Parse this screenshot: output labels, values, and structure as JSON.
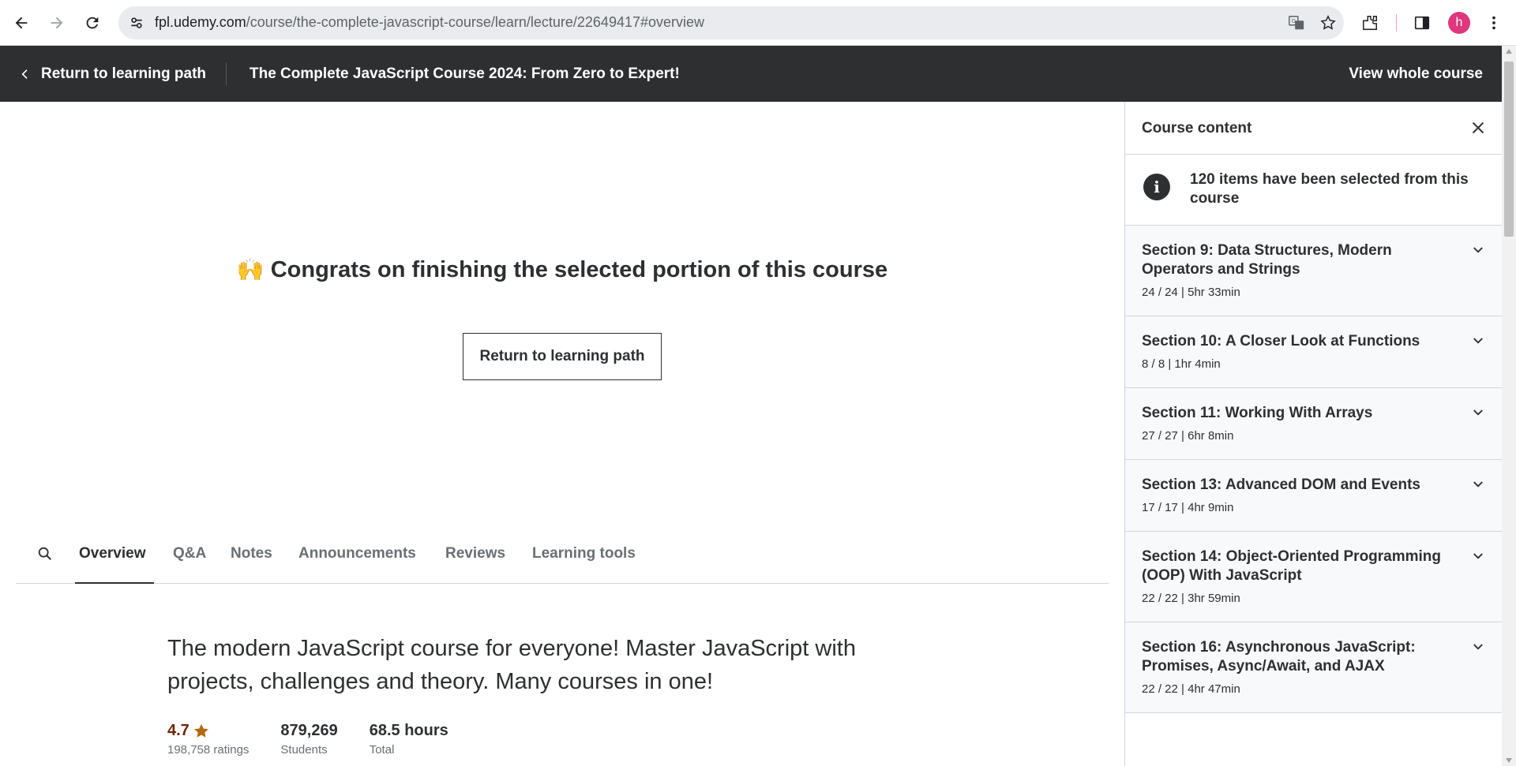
{
  "browser": {
    "url_host": "fpl.udemy.com",
    "url_path": "/course/the-complete-javascript-course/learn/lecture/22649417#overview",
    "profile_initial": "h",
    "profile_color": "#e0367d"
  },
  "header": {
    "back_label": "Return to learning path",
    "course_title": "The Complete JavaScript Course 2024: From Zero to Expert!",
    "view_whole_label": "View whole course"
  },
  "main": {
    "congrats_emoji": "🙌",
    "congrats_text": "Congrats on finishing the selected portion of this course",
    "return_button": "Return to learning path",
    "tabs": [
      {
        "label": "Overview",
        "active": true
      },
      {
        "label": "Q&A"
      },
      {
        "label": "Notes"
      },
      {
        "label": "Announcements"
      },
      {
        "label": "Reviews"
      },
      {
        "label": "Learning tools"
      }
    ],
    "description": "The modern JavaScript course for everyone! Master JavaScript with projects, challenges and theory. Many courses in one!",
    "stats": {
      "rating": "4.7",
      "ratings_count": "198,758 ratings",
      "students": "879,269",
      "students_label": "Students",
      "hours": "68.5 hours",
      "hours_label": "Total"
    }
  },
  "sidebar": {
    "title": "Course content",
    "info_text": "120 items have been selected from this course",
    "sections": [
      {
        "title": "Section 9: Data Structures, Modern Operators and Strings",
        "meta": "24 / 24 | 5hr 33min"
      },
      {
        "title": "Section 10: A Closer Look at Functions",
        "meta": "8 / 8 | 1hr 4min"
      },
      {
        "title": "Section 11: Working With Arrays",
        "meta": "27 / 27 | 6hr 8min"
      },
      {
        "title": "Section 13: Advanced DOM and Events",
        "meta": "17 / 17 | 4hr 9min"
      },
      {
        "title": "Section 14: Object-Oriented Programming (OOP) With JavaScript",
        "meta": "22 / 22 | 3hr 59min"
      },
      {
        "title": "Section 16: Asynchronous JavaScript: Promises, Async/Await, and AJAX",
        "meta": "22 / 22 | 4hr 47min"
      }
    ]
  },
  "colors": {
    "header_bg": "#2d2f31",
    "sidebar_section_bg": "#f7f9fa",
    "star": "#b4690e"
  }
}
